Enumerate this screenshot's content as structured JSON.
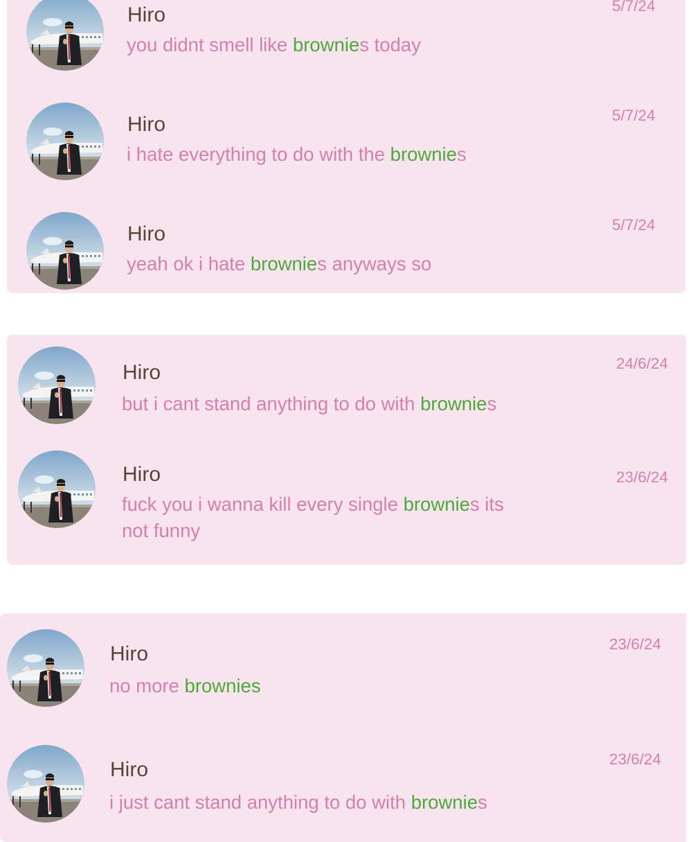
{
  "groups": [
    {
      "messages": [
        {
          "sender": "Hiro",
          "text_before": "you didnt smell like ",
          "highlight": "brownie",
          "text_after": "s today",
          "date": "5/7/24"
        },
        {
          "sender": "Hiro",
          "text_before": "i hate everything to do with the ",
          "highlight": "brownie",
          "text_after": "s",
          "date": "5/7/24"
        },
        {
          "sender": "Hiro",
          "text_before": "yeah ok i hate ",
          "highlight": "brownie",
          "text_after": "s anyways so",
          "date": "5/7/24"
        }
      ]
    },
    {
      "messages": [
        {
          "sender": "Hiro",
          "text_before": "but i cant stand anything to do with ",
          "highlight": "brownie",
          "text_after": "s",
          "date": "24/6/24"
        },
        {
          "sender": "Hiro",
          "text_before": "fuck you i wanna kill every single ",
          "highlight": "brownie",
          "text_after": "s its\nnot funny",
          "date": "23/6/24"
        }
      ]
    },
    {
      "messages": [
        {
          "sender": "Hiro",
          "text_before": "no more ",
          "highlight": "brownies",
          "text_after": "",
          "date": "23/6/24"
        },
        {
          "sender": "Hiro",
          "text_before": "i just cant stand anything to do with ",
          "highlight": "brownie",
          "text_after": "s",
          "date": "23/6/24"
        }
      ]
    }
  ],
  "colors": {
    "panel_background": "#f7e4ee",
    "sender": "#5a4237",
    "message_text": "#d381ab",
    "highlight": "#4ea83a",
    "date": "#d381ab"
  },
  "icons": {
    "avatar": "profile-photo-man-in-suit-with-jet"
  }
}
